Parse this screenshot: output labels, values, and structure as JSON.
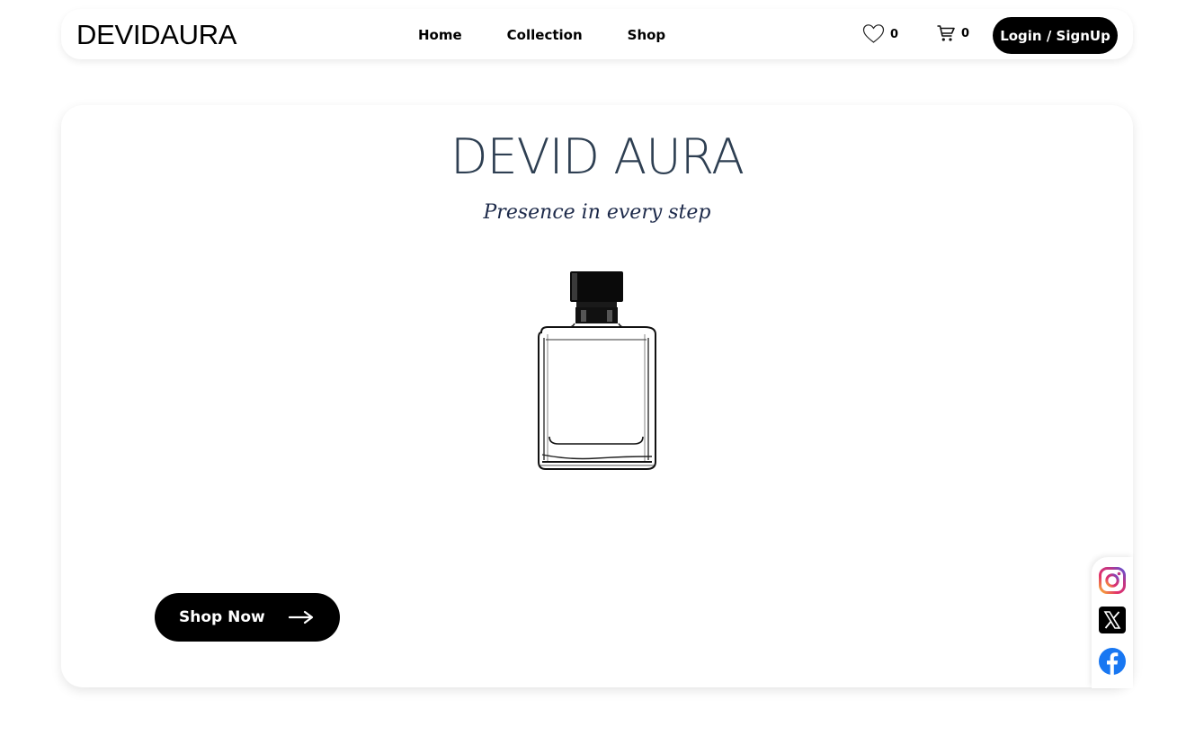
{
  "header": {
    "brand": "DEVIDAURA",
    "nav": [
      "Home",
      "Collection",
      "Shop"
    ],
    "wishlist_icon": "heart-icon",
    "wishlist_count": "0",
    "cart_icon": "cart-icon",
    "cart_count": "0",
    "login_label": "Login / SignUp"
  },
  "hero": {
    "title": "DEVID AURA",
    "tagline": "Presence in every step",
    "image": "perfume-bottle",
    "cta_label": "Shop Now",
    "cta_icon": "arrow-right-icon"
  },
  "social": {
    "items": [
      "instagram-icon",
      "x-icon",
      "facebook-icon"
    ]
  },
  "colors": {
    "title": "#2e3f52",
    "tagline": "#1d2a4a",
    "button_bg": "#000000",
    "facebook": "#1877f2"
  }
}
